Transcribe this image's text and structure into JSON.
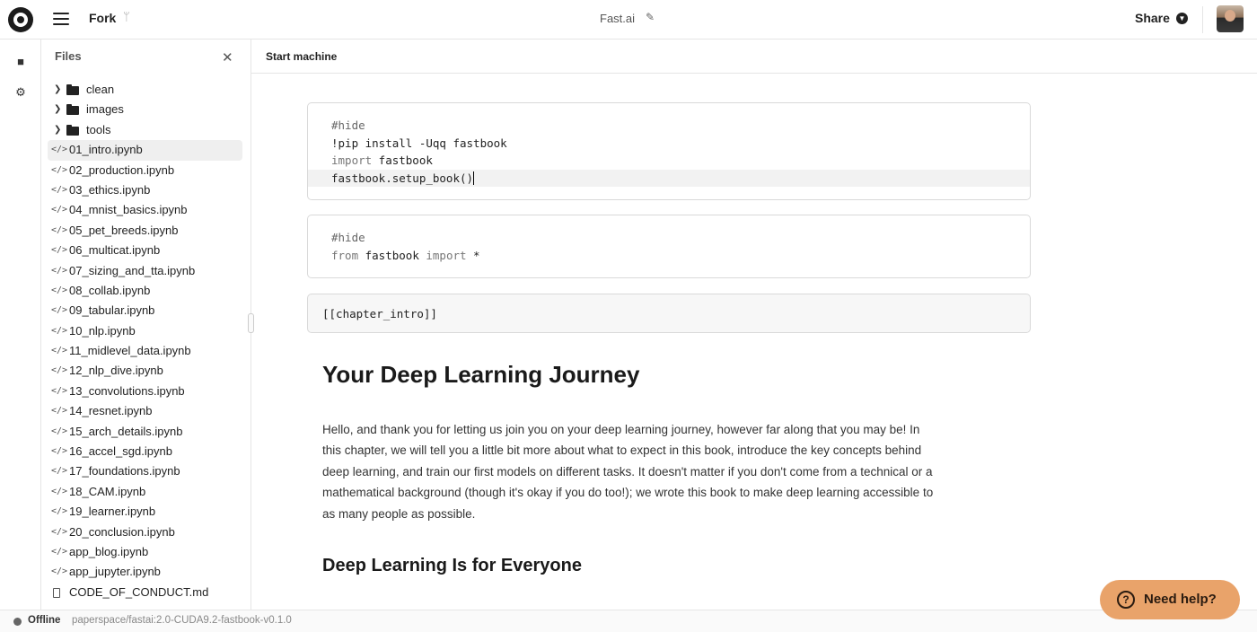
{
  "header": {
    "logo": "paperspace-logo",
    "fork_label": "Fork",
    "fork_icon": "fork-icon",
    "doc_title": "Fast.ai",
    "share_label": "Share"
  },
  "rail": {
    "icons": [
      "folder-icon",
      "chip-icon"
    ]
  },
  "files": {
    "title": "Files",
    "folders": [
      "clean",
      "images",
      "tools"
    ],
    "notebooks": [
      "01_intro.ipynb",
      "02_production.ipynb",
      "03_ethics.ipynb",
      "04_mnist_basics.ipynb",
      "05_pet_breeds.ipynb",
      "06_multicat.ipynb",
      "07_sizing_and_tta.ipynb",
      "08_collab.ipynb",
      "09_tabular.ipynb",
      "10_nlp.ipynb",
      "11_midlevel_data.ipynb",
      "12_nlp_dive.ipynb",
      "13_convolutions.ipynb",
      "14_resnet.ipynb",
      "15_arch_details.ipynb",
      "16_accel_sgd.ipynb",
      "17_foundations.ipynb",
      "18_CAM.ipynb",
      "19_learner.ipynb",
      "20_conclusion.ipynb",
      "app_blog.ipynb",
      "app_jupyter.ipynb"
    ],
    "documents": [
      "CODE_OF_CONDUCT.md"
    ],
    "active": "01_intro.ipynb"
  },
  "main": {
    "toolbar_label": "Start machine",
    "cell1": {
      "comment": "#hide",
      "line2": "!pip install -Uqq fastbook",
      "line3_kw": "import",
      "line3_rest": " fastbook",
      "line4": "fastbook.setup_book()"
    },
    "cell2": {
      "comment": "#hide",
      "kw_from": "from",
      "module": " fastbook ",
      "kw_import": "import",
      "rest": " *"
    },
    "cell3": {
      "text": "[[chapter_intro]]"
    },
    "heading": "Your Deep Learning Journey",
    "paragraph": "Hello, and thank you for letting us join you on your deep learning journey, however far along that you may be! In this chapter, we will tell you a little bit more about what to expect in this book, introduce the key concepts behind deep learning, and train our first models on different tasks. It doesn't matter if you don't come from a technical or a mathematical background (though it's okay if you do too!); we wrote this book to make deep learning accessible to as many people as possible.",
    "subheading": "Deep Learning Is for Everyone"
  },
  "status": {
    "state": "Offline",
    "environment": "paperspace/fastai:2.0-CUDA9.2-fastbook-v0.1.0"
  },
  "help": {
    "label": "Need help?"
  }
}
